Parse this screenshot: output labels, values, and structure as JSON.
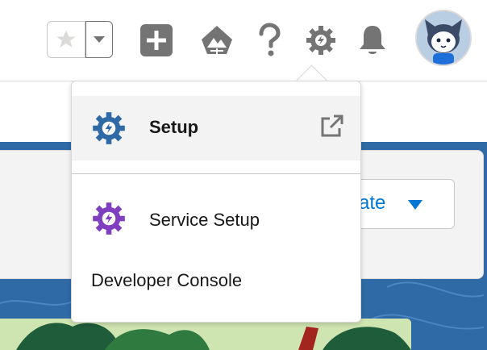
{
  "header": {
    "favorites": {
      "star_icon": "star-icon",
      "menu_icon": "chevron-down-icon"
    },
    "icons": [
      {
        "name": "global-actions-icon",
        "color": "#747474"
      },
      {
        "name": "trailhead-guidance-icon",
        "color": "#747474"
      },
      {
        "name": "help-icon",
        "color": "#747474"
      },
      {
        "name": "setup-gear-icon",
        "color": "#747474"
      },
      {
        "name": "notifications-bell-icon",
        "color": "#747474"
      }
    ],
    "avatar_icon": "user-avatar"
  },
  "page": {
    "create_button": {
      "label": "ate"
    }
  },
  "dropdown": {
    "items": [
      {
        "label": "Setup",
        "icon": "setup-gear-icon",
        "icon_color": "#2f6aa6",
        "trailing_icon": "external-link-icon",
        "selected": true
      },
      {
        "label": "Service Setup",
        "icon": "service-setup-gear-icon",
        "icon_color": "#7f3fbf"
      },
      {
        "label": "Developer Console"
      }
    ]
  },
  "colors": {
    "accent": "#0176d3",
    "banner": "#2f6aa6",
    "header_icon": "#747474"
  }
}
